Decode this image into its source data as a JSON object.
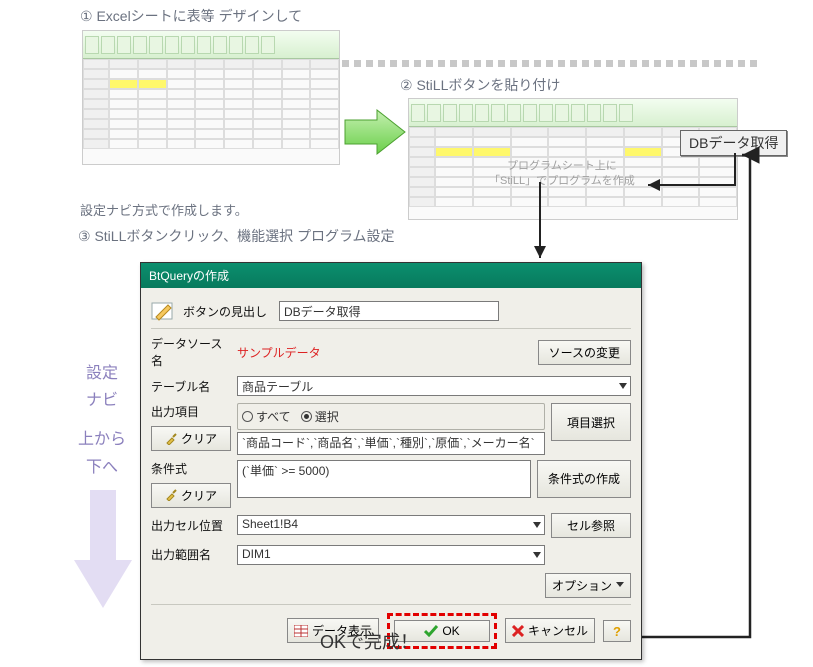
{
  "steps": {
    "s1": "① Excelシートに表等 デザインして",
    "s2": "② StiLLボタンを貼り付け",
    "s3_intro": "設定ナビ方式で作成します。",
    "s3": "③ StiLLボタンクリック、機能選択 プログラム設定"
  },
  "excel2_note": {
    "line1": "プログラムシート上に",
    "line2": "「StiLL」でプログラムを作成"
  },
  "db_button": "DBデータ取得",
  "dialog": {
    "title": "BtQueryの作成",
    "caption_label": "ボタンの見出し",
    "caption_value": "DBデータ取得",
    "ds_label": "データソース名",
    "ds_value": "サンプルデータ",
    "change_source": "ソースの変更",
    "table_label": "テーブル名",
    "table_value": "商品テーブル",
    "outcols_label": "出力項目",
    "radio_all": "すべて",
    "radio_sel": "選択",
    "select_items": "項目選択",
    "clear": "クリア",
    "cols_value": "`商品コード`,`商品名`,`単価`,`種別`,`原価`,`メーカー名`",
    "cond_label": "条件式",
    "cond_value": "(`単価` >= 5000)",
    "cond_build": "条件式の作成",
    "outcell_label": "出力セル位置",
    "outcell_value": "Sheet1!B4",
    "cellref": "セル参照",
    "range_label": "出力範囲名",
    "range_value": "DIM1",
    "option": "オプション",
    "show_data": "データ表示",
    "ok": "OK",
    "cancel": "キャンセル"
  },
  "side": {
    "l1": "設定",
    "l2": "ナビ",
    "l3": "上から",
    "l4": "下へ"
  },
  "completion": "OKで完成！"
}
